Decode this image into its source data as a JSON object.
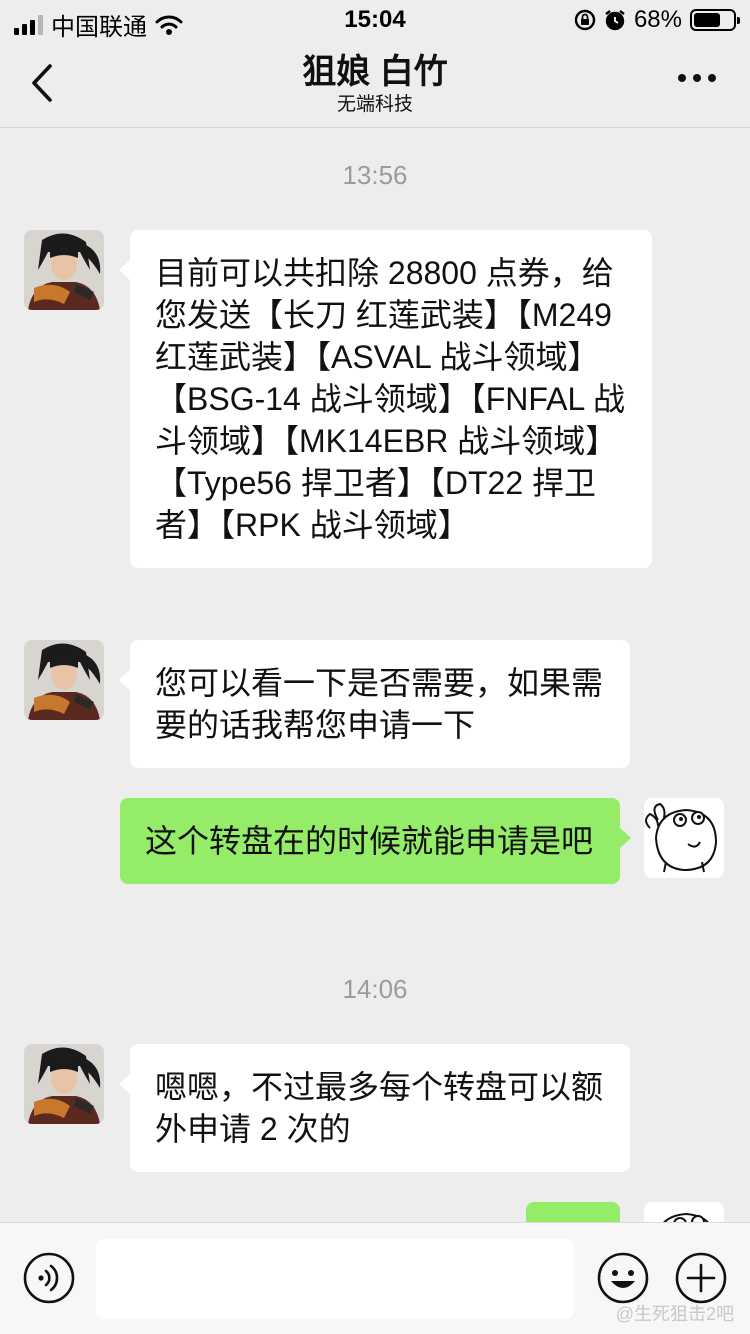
{
  "status_bar": {
    "carrier": "中国联通",
    "time": "15:04",
    "battery_percent": "68%",
    "battery_level": 0.68
  },
  "nav": {
    "title": "狙娘 白竹",
    "subtitle": "无端科技"
  },
  "messages": {
    "timestamp_1": "13:56",
    "msg_1": "目前可以共扣除 28800 点券，给您发送【长刀 红莲武装】【M249 红莲武装】【ASVAL 战斗领域】【BSG-14 战斗领域】【FNFAL 战斗领域】【MK14EBR 战斗领域】【Type56 捍卫者】【DT22 捍卫者】【RPK 战斗领域】",
    "msg_2": "您可以看一下是否需要，如果需要的话我帮您申请一下",
    "msg_3": "这个转盘在的时候就能申请是吧",
    "timestamp_2": "14:06",
    "msg_4": "嗯嗯，不过最多每个转盘可以额外申请 2 次的"
  },
  "input_bar": {
    "text": ""
  },
  "watermark": "@生死狙击2吧",
  "icons": {
    "back": "chevron-left-icon",
    "more": "more-dots-icon",
    "voice": "voice-icon",
    "emoji": "emoji-icon",
    "plus": "plus-icon",
    "wifi": "wifi-icon",
    "signal": "signal-icon",
    "battery": "battery-icon",
    "lock": "rotation-lock-icon",
    "alarm": "alarm-icon"
  },
  "colors": {
    "background": "#ededed",
    "incoming_bubble": "#ffffff",
    "outgoing_bubble": "#95ec69",
    "timestamp": "#9b9b9b"
  }
}
